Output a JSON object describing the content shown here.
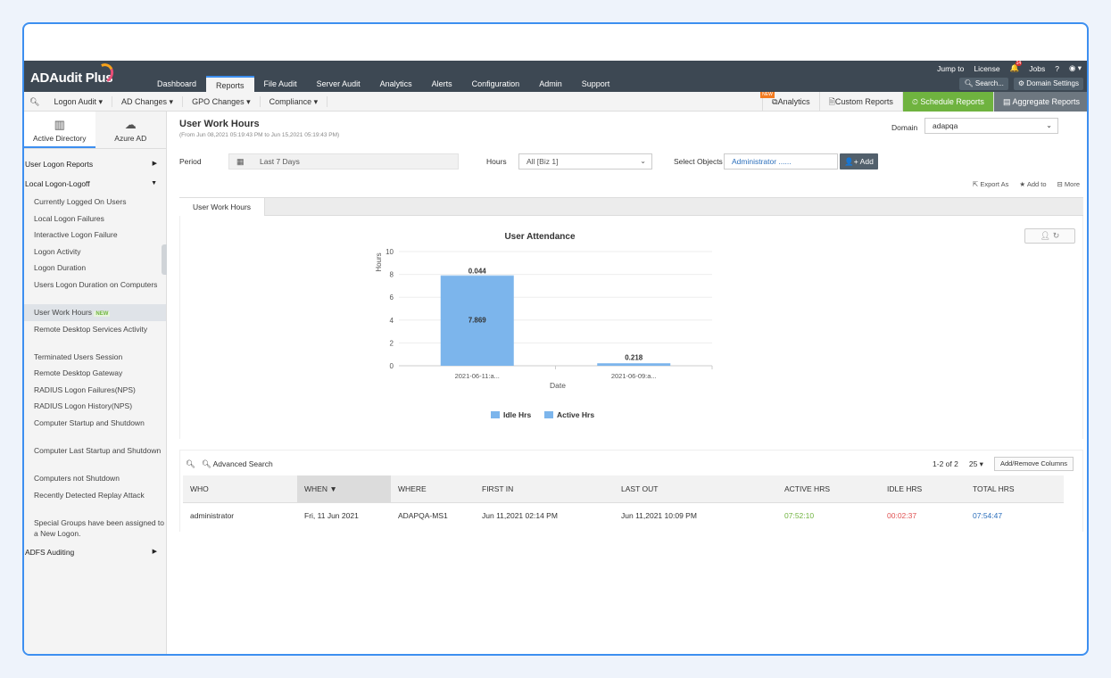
{
  "app": {
    "name": "ADAudit Plus"
  },
  "tabs": [
    {
      "label": "Dashboard",
      "active": false
    },
    {
      "label": "Reports",
      "active": true
    },
    {
      "label": "File Audit",
      "active": false
    },
    {
      "label": "Server Audit",
      "active": false
    },
    {
      "label": "Analytics",
      "active": false
    },
    {
      "label": "Alerts",
      "active": false
    },
    {
      "label": "Configuration",
      "active": false
    },
    {
      "label": "Admin",
      "active": false
    },
    {
      "label": "Support",
      "active": false
    }
  ],
  "toplinks": {
    "jump": "Jump to",
    "license": "License",
    "bell_count": "14",
    "jobs": "Jobs",
    "help": "?",
    "user": "●"
  },
  "toolbuttons": {
    "search": "Search...",
    "domain_settings": "Domain Settings"
  },
  "subnav": [
    "Logon Audit",
    "AD Changes",
    "GPO Changes",
    "Compliance"
  ],
  "subright": {
    "analytics": "Analytics",
    "new_flag": "NEW",
    "custom": "Custom Reports",
    "schedule": "Schedule Reports",
    "aggregate": "Aggregate Reports"
  },
  "sidebar": {
    "tab1": "Active Directory",
    "tab2": "Azure AD",
    "sec_user_logon": "User Logon Reports",
    "sec_local": "Local Logon-Logoff",
    "items": [
      "Currently Logged On Users",
      "Local Logon Failures",
      "Interactive Logon Failure",
      "Logon Activity",
      "Logon Duration",
      "Users Logon Duration on Computers",
      "User Work Hours",
      "Remote Desktop Services Activity",
      "Terminated Users Session",
      "Remote Desktop Gateway",
      "RADIUS Logon Failures(NPS)",
      "RADIUS Logon History(NPS)",
      "Computer Startup and Shutdown",
      "Computer Last Startup and Shutdown",
      "Computers not Shutdown",
      "Recently Detected Replay Attack",
      "Special Groups have been assigned to a New Logon."
    ],
    "new_badge": "NEW",
    "sec_adfs": "ADFS Auditing"
  },
  "page": {
    "title": "User Work Hours",
    "subtitle": "(From Jun 08,2021 05:19:43 PM to Jun 15,2021 05:19:43 PM)",
    "domain_label": "Domain",
    "domain_value": "adapqa",
    "period_label": "Period",
    "period_value": "Last 7 Days",
    "hours_label": "Hours",
    "hours_value": "All [Biz 1]",
    "objects_label": "Select Objects",
    "objects_value": "Administrator ......",
    "add_label": "Add",
    "export": "Export As",
    "addto": "Add to",
    "more": "More",
    "report_tab": "User Work Hours"
  },
  "chart_data": {
    "type": "bar",
    "title": "User Attendance",
    "xlabel": "Date",
    "ylabel": "Hours",
    "ylim": [
      0,
      10
    ],
    "yticks": [
      0,
      2,
      4,
      6,
      8,
      10
    ],
    "categories": [
      "2021-06-11:a...",
      "2021-06-09:a..."
    ],
    "series": [
      {
        "name": "Active Hrs",
        "values": [
          7.869,
          0.218
        ],
        "color": "#7cb5ec"
      },
      {
        "name": "Idle Hrs",
        "values": [
          0.044,
          0
        ],
        "color": "#7cb5ec"
      }
    ],
    "legend_position": "bottom",
    "stack_labels": [
      "0.044",
      "7.869",
      "0.218"
    ]
  },
  "grid": {
    "advanced_search": "Advanced Search",
    "paging": "1-2 of 2",
    "per_page": "25",
    "addremove": "Add/Remove Columns",
    "columns": [
      "WHO",
      "WHEN",
      "WHERE",
      "FIRST IN",
      "LAST OUT",
      "ACTIVE HRS",
      "IDLE HRS",
      "TOTAL HRS"
    ],
    "rows": [
      [
        "administrator",
        "Fri, 11 Jun 2021",
        "ADAPQA-MS1",
        "Jun 11,2021 02:14 PM",
        "Jun 11,2021 10:09 PM",
        "07:52:10",
        "00:02:37",
        "07:54:47"
      ]
    ]
  }
}
